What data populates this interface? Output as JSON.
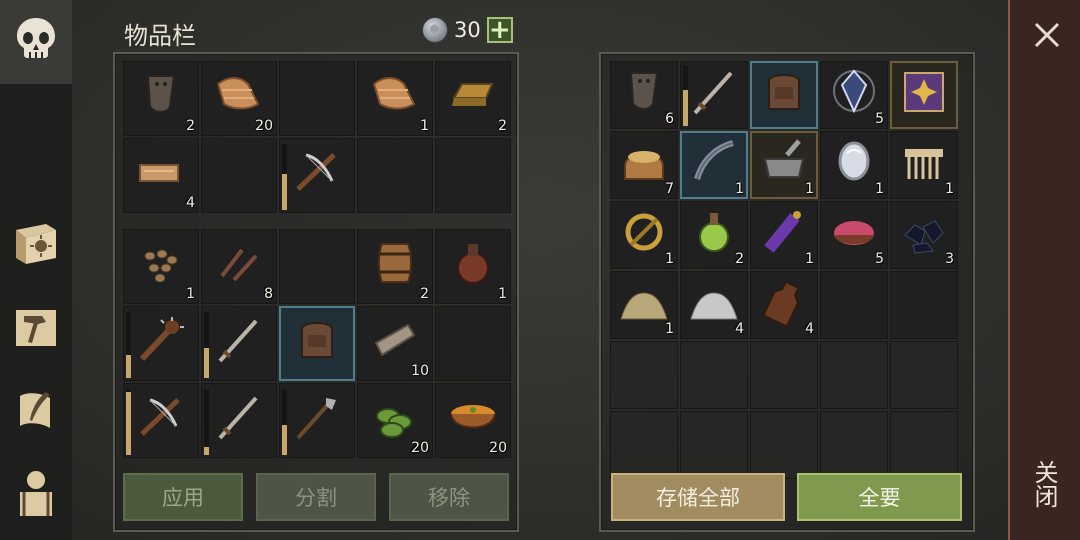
{
  "header": {
    "title": "物品栏",
    "currency": "30",
    "add_label": "+"
  },
  "nav": {
    "items": [
      "skull-icon",
      "sun-book-icon",
      "hammer-icon",
      "scroll-quill-icon",
      "backpack-icon"
    ]
  },
  "inventory": {
    "top": [
      {
        "name": "leather-pauldron-icon",
        "qty": "2"
      },
      {
        "name": "cloth-roll-icon",
        "qty": "20"
      },
      {
        "name": "",
        "qty": ""
      },
      {
        "name": "cloth-roll-icon",
        "qty": "1"
      },
      {
        "name": "ingot-icon",
        "qty": "2"
      },
      {
        "name": "folded-leather-icon",
        "qty": "4"
      },
      {
        "name": "",
        "qty": ""
      },
      {
        "name": "crossbow-icon",
        "qty": "",
        "dur": 0.55
      },
      {
        "name": "",
        "qty": ""
      },
      {
        "name": "",
        "qty": ""
      }
    ],
    "bottom": [
      {
        "name": "seeds-icon",
        "qty": "1"
      },
      {
        "name": "nails-icon",
        "qty": "8"
      },
      {
        "name": "",
        "qty": ""
      },
      {
        "name": "barrel-icon",
        "qty": "2"
      },
      {
        "name": "flask-icon",
        "qty": "1"
      },
      {
        "name": "spiked-club-icon",
        "qty": "",
        "dur": 0.35
      },
      {
        "name": "sword-icon",
        "qty": "",
        "dur": 0.45
      },
      {
        "name": "backpack-item-icon",
        "qty": "",
        "sel": true
      },
      {
        "name": "plank-icon",
        "qty": "10"
      },
      {
        "name": "",
        "qty": ""
      },
      {
        "name": "crossbow-icon",
        "qty": "",
        "dur": 0.95
      },
      {
        "name": "sword-icon",
        "qty": "",
        "dur": 0.12
      },
      {
        "name": "halberd-icon",
        "qty": "",
        "dur": 0.45
      },
      {
        "name": "green-rings-icon",
        "qty": "20"
      },
      {
        "name": "soup-bowl-icon",
        "qty": "20"
      }
    ],
    "buttons": {
      "apply": "应用",
      "split": "分割",
      "remove": "移除"
    }
  },
  "storage": {
    "cells": [
      {
        "name": "leather-pauldron-icon",
        "qty": "6"
      },
      {
        "name": "sword-icon",
        "qty": "",
        "dur": 0.6
      },
      {
        "name": "backpack-item-icon",
        "qty": "",
        "sel": true
      },
      {
        "name": "crystal-icon",
        "qty": "5"
      },
      {
        "name": "spellbook-icon",
        "qty": "",
        "rare": true
      },
      {
        "name": "grain-sack-icon",
        "qty": "7"
      },
      {
        "name": "bow-part-icon",
        "qty": "1",
        "sel": true
      },
      {
        "name": "mortar-icon",
        "qty": "1",
        "rare": true
      },
      {
        "name": "mirror-icon",
        "qty": "1"
      },
      {
        "name": "comb-icon",
        "qty": "1"
      },
      {
        "name": "ring-icon",
        "qty": "1"
      },
      {
        "name": "green-potion-icon",
        "qty": "2"
      },
      {
        "name": "purple-potion-icon",
        "qty": "1"
      },
      {
        "name": "meat-bowl-icon",
        "qty": "5"
      },
      {
        "name": "coal-icon",
        "qty": "3"
      },
      {
        "name": "sand-pile-icon",
        "qty": "1"
      },
      {
        "name": "salt-pile-icon",
        "qty": "4"
      },
      {
        "name": "bottle-icon",
        "qty": "4"
      },
      {
        "name": "",
        "qty": ""
      },
      {
        "name": "",
        "qty": ""
      },
      {
        "name": "",
        "qty": "",
        "dim": true
      },
      {
        "name": "",
        "qty": "",
        "dim": true
      },
      {
        "name": "",
        "qty": "",
        "dim": true
      },
      {
        "name": "",
        "qty": "",
        "dim": true
      },
      {
        "name": "",
        "qty": "",
        "dim": true
      },
      {
        "name": "",
        "qty": "",
        "dim": true
      },
      {
        "name": "",
        "qty": "",
        "dim": true
      },
      {
        "name": "",
        "qty": "",
        "dim": true
      },
      {
        "name": "",
        "qty": "",
        "dim": true
      },
      {
        "name": "",
        "qty": "",
        "dim": true
      }
    ],
    "buttons": {
      "store_all": "存储全部",
      "take_all": "全要"
    }
  },
  "close": {
    "label": "关闭"
  }
}
